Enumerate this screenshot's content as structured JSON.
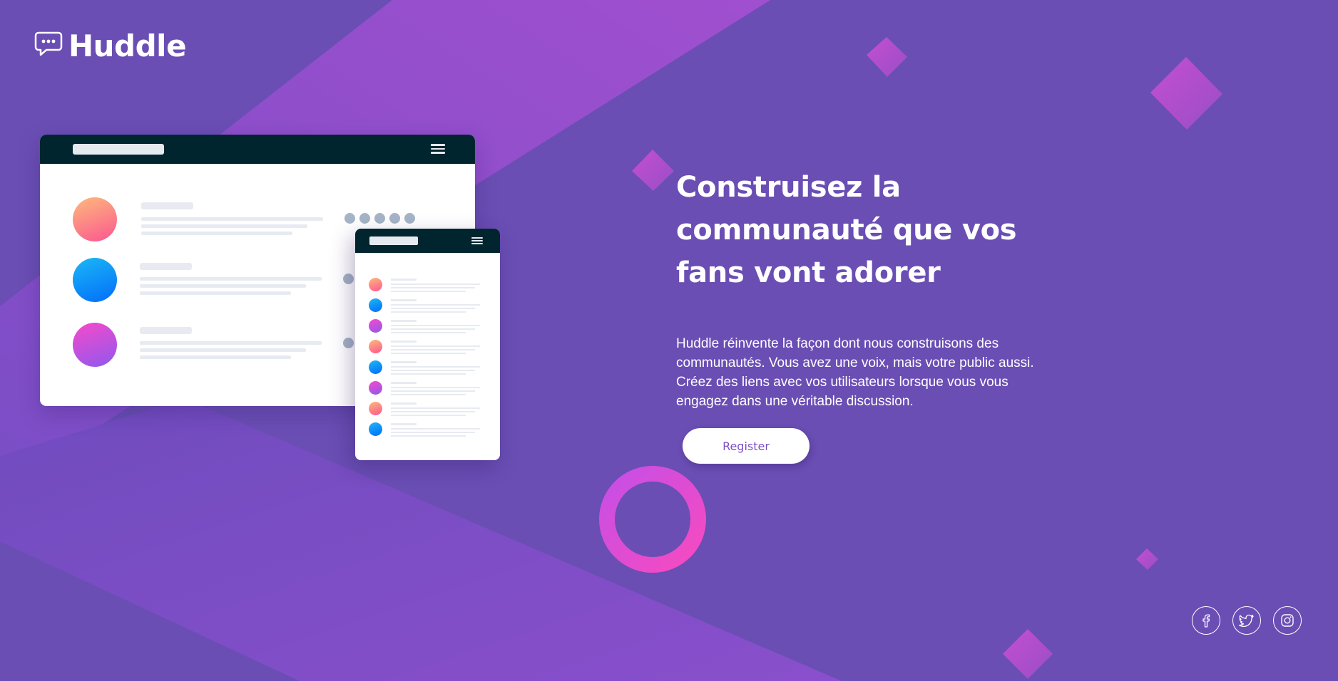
{
  "brand": {
    "name": "Huddle",
    "logo_icon": "chat-bubble-icon"
  },
  "hero": {
    "title_lines": [
      "Construisez la",
      "communauté que vos",
      "fans vont adorer"
    ],
    "description": "Huddle réinvente la façon dont nous construisons des communautés. Vous avez une voix, mais votre public aussi. Créez des liens avec vos utilisateurs lorsque vous vous engagez dans une véritable discussion.",
    "cta_label": "Register"
  },
  "socials": [
    {
      "name": "facebook",
      "icon": "facebook-icon"
    },
    {
      "name": "twitter",
      "icon": "twitter-icon"
    },
    {
      "name": "instagram",
      "icon": "instagram-icon"
    }
  ],
  "colors": {
    "background": "#6a4eb4",
    "accent_pink": "#f74aca",
    "mock_header": "#00252e",
    "button_text": "#7b4fc4"
  }
}
